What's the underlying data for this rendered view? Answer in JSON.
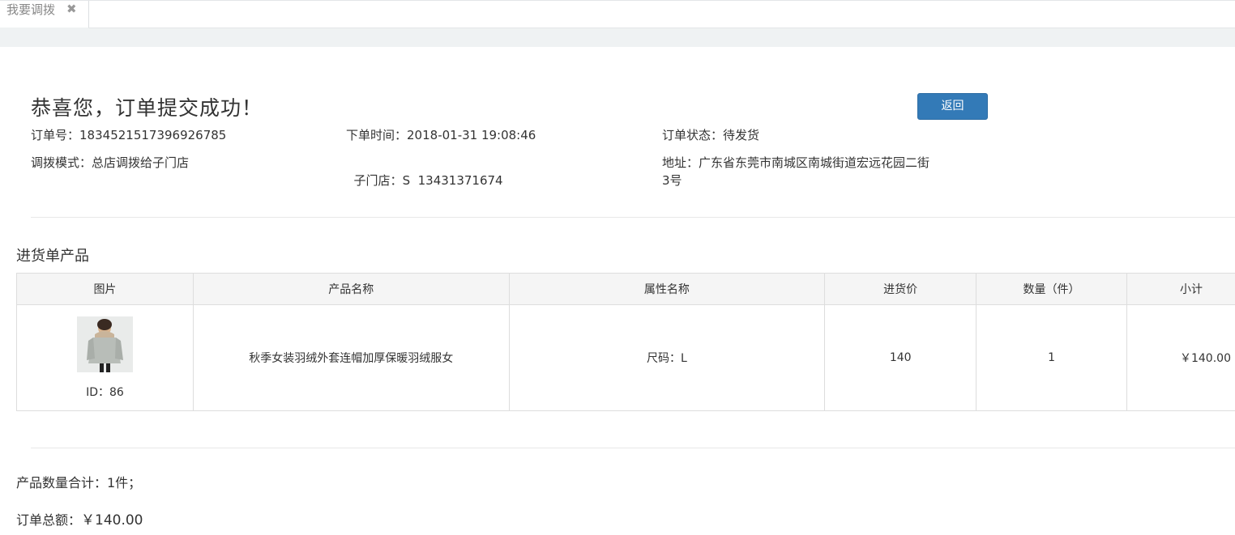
{
  "tabs": [
    {
      "label": "我要调拨",
      "close_glyph": "✖"
    }
  ],
  "order": {
    "success_title": "恭喜您，订单提交成功！",
    "back_label": "返回",
    "number_label": "订单号：",
    "number_value": "1834521517396926785",
    "time_label": "下单时间：",
    "time_value": "2018-01-31 19:08:46",
    "status_label": "订单状态：",
    "status_value": "待发货",
    "mode_label": "调拨模式：",
    "mode_value": "总店调拨给子门店",
    "store_label": "子门店：",
    "store_value": "S  13431371674",
    "address_label": "地址：",
    "address_value_line1": "广东省东莞市南城区南城街道宏远花园二街",
    "address_value_line2": "3号"
  },
  "products_section": {
    "title": "进货单产品",
    "columns": [
      "图片",
      "产品名称",
      "属性名称",
      "进货价",
      "数量（件）",
      "小计"
    ],
    "rows": [
      {
        "id_text": "ID：86",
        "name": "秋季女装羽绒外套连帽加厚保暖羽绒服女",
        "attributes": "尺码：L",
        "price": "140",
        "quantity": "1",
        "subtotal": "￥140.00"
      }
    ]
  },
  "summary": {
    "count_text": "产品数量合计：1件；",
    "total_label": "订单总额：",
    "total_value": "￥140.00"
  },
  "colors": {
    "accent": "#337ab7",
    "tabbar_bg": "#eff2f3",
    "table_header_bg": "#f5f5f5"
  }
}
